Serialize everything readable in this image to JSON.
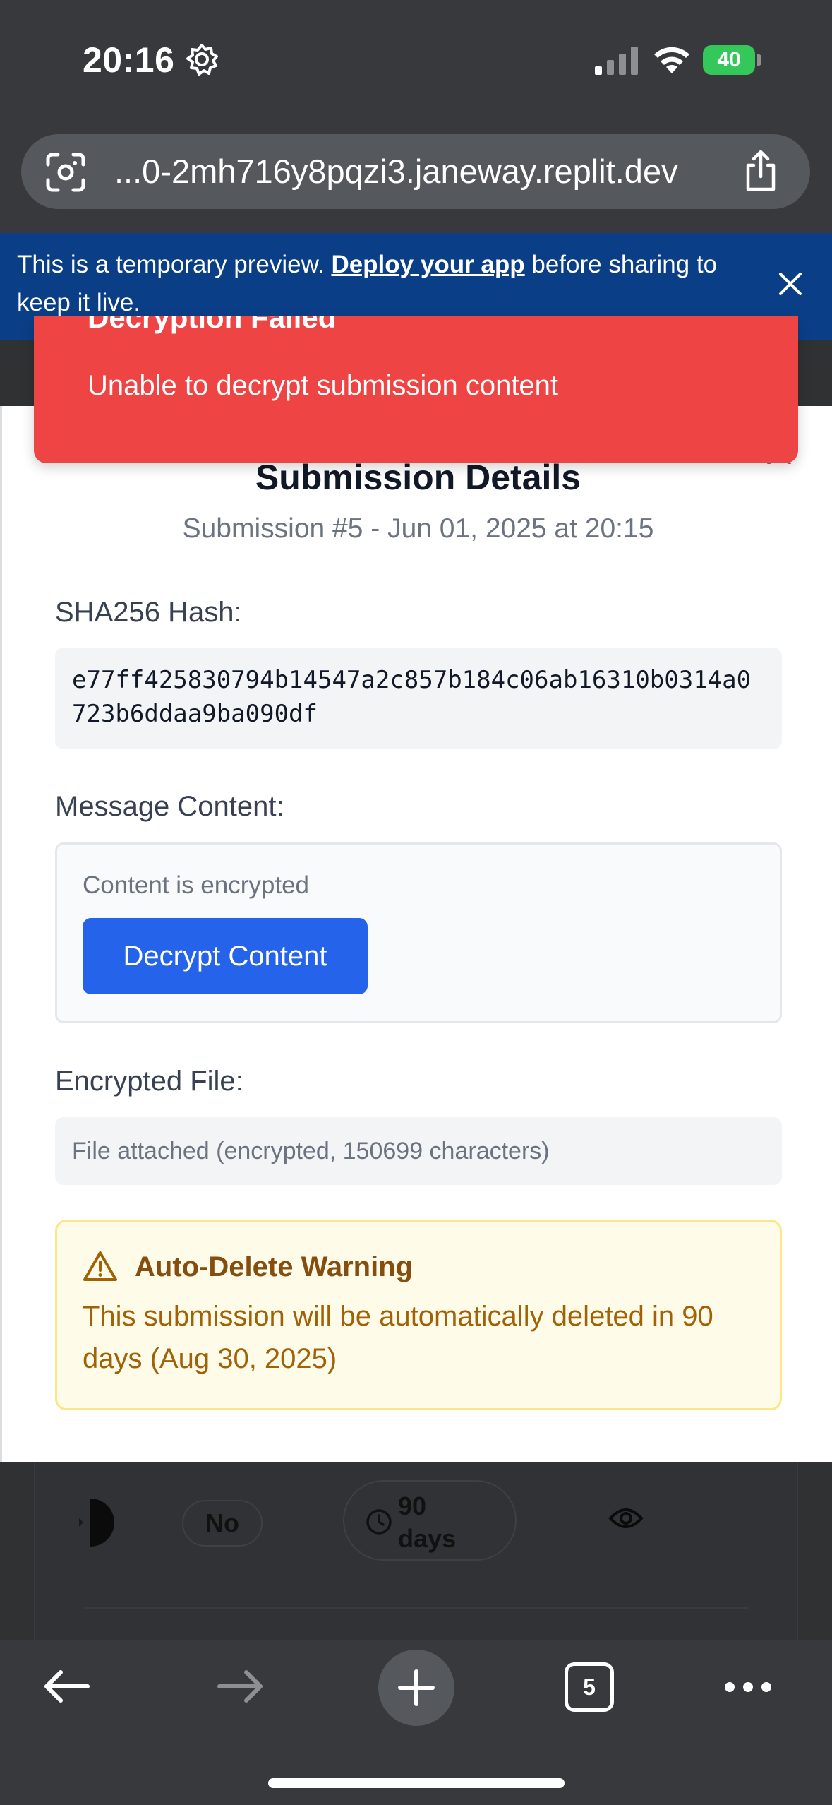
{
  "status_bar": {
    "time": "20:16",
    "battery_level": "40",
    "icons": [
      "gear-icon",
      "cellular-signal-icon",
      "wifi-icon",
      "battery-charging-icon"
    ],
    "colors": {
      "battery": "#34c759"
    }
  },
  "browser": {
    "url": "...0-2mh716y8pqzi3.janeway.replit.dev",
    "icons": [
      "scan-icon",
      "share-icon"
    ]
  },
  "preview_banner": {
    "text_before": "This is a temporary preview. ",
    "link": "Deploy your app",
    "text_after": " before sharing to keep it live.",
    "icon": "close-icon",
    "colors": {
      "background": "#0a3f88"
    }
  },
  "toast": {
    "title": "Decryption Failed",
    "message": "Unable to decrypt submission content",
    "colors": {
      "background": "#ef4444"
    }
  },
  "modal": {
    "title": "Submission Details",
    "subtitle": "Submission #5 - Jun 01, 2025 at 20:15",
    "hash_label": "SHA256 Hash:",
    "hash_value": "e77ff425830794b14547a2c857b184c06ab16310b0314a0723b6ddaa9ba090df",
    "message_label": "Message Content:",
    "encrypted_note": "Content is encrypted",
    "decrypt_button": "Decrypt Content",
    "file_label": "Encrypted File:",
    "file_info": "File attached (encrypted, 150699 characters)",
    "warning_title": "Auto-Delete Warning",
    "warning_text": "This submission will be automatically deleted in 90 days (Aug 30, 2025)",
    "colors": {
      "primary": "#2563eb",
      "warning_bg": "#fefce8",
      "warning_text": "#a16207"
    }
  },
  "background_row": {
    "pill": "No",
    "days_line1": "90",
    "days_line2": "days",
    "icons": [
      "clock-icon",
      "eye-icon"
    ]
  },
  "toolbar": {
    "tab_count": "5",
    "icons": [
      "back-arrow-icon",
      "forward-arrow-icon",
      "plus-icon",
      "tabs-icon",
      "more-icon"
    ]
  }
}
